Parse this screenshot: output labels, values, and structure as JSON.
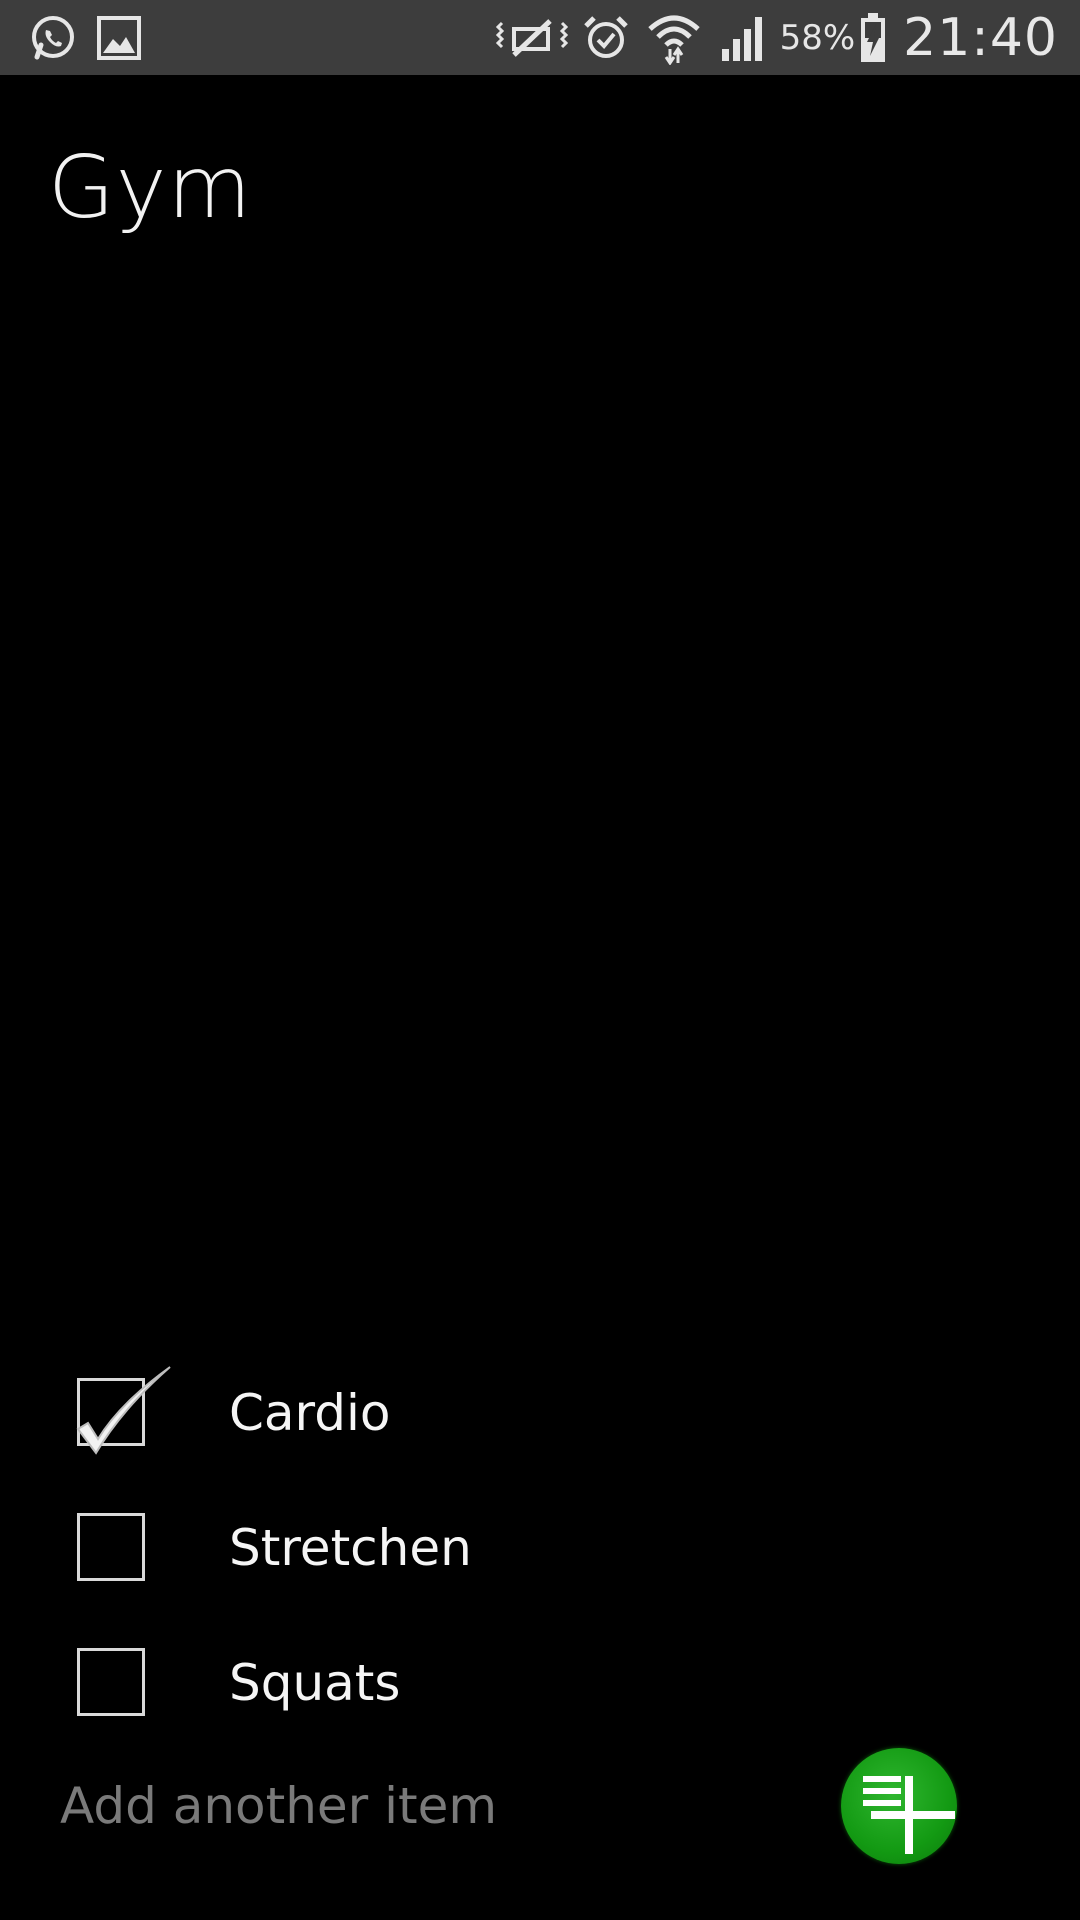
{
  "status_bar": {
    "left_icons": [
      "whatsapp-icon",
      "gallery-icon"
    ],
    "right_icons": [
      "vibrate-mute-icon",
      "alarm-icon",
      "wifi-icon",
      "signal-icon",
      "battery-charging-icon"
    ],
    "battery_percent": "58%",
    "time": "21:40"
  },
  "page": {
    "title": "Gym"
  },
  "checklist": {
    "items": [
      {
        "label": "Cardio",
        "checked": true
      },
      {
        "label": "Stretchen",
        "checked": false
      },
      {
        "label": "Squats",
        "checked": false
      }
    ]
  },
  "add_item": {
    "placeholder": "Add another item",
    "button_icon": "add-list-icon",
    "button_color": "#139a13"
  }
}
